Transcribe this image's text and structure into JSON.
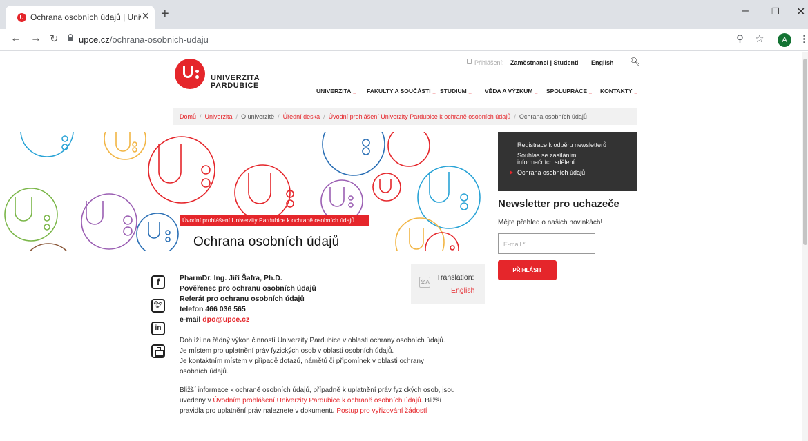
{
  "browser": {
    "tab_title": "Ochrana osobních údajů | Univerz",
    "url_domain": "upce.cz",
    "url_path": "/ochrana-osobnich-udaju",
    "profile_initial": "A"
  },
  "header": {
    "logo_line1": "UNIVERZITA",
    "logo_line2": "PARDUBICE",
    "login_label": "Přihlášení:",
    "login_links": "Zaměstnanci | Studenti",
    "lang": "English"
  },
  "nav": [
    "UNIVERZITA",
    "FAKULTY A SOUČÁSTI",
    "STUDIUM",
    "VĚDA A VÝZKUM",
    "SPOLUPRÁCE",
    "KONTAKTY"
  ],
  "breadcrumb": {
    "links": [
      "Domů",
      "Univerzita"
    ],
    "plain1": "O univerzitě",
    "links2": [
      "Úřední deska",
      "Úvodní prohlášení Univerzity Pardubice k ochraně osobních údajů"
    ],
    "current": "Ochrana osobních údajů"
  },
  "hero": {
    "label": "Úvodní prohlášení Univerzity Pardubice k ochraně osobních údajů",
    "title": "Ochrana osobních údajů"
  },
  "sidebar": {
    "items": [
      "Registrace k odběru newsletterů",
      "Souhlas se zasíláním",
      "informačních sdělení",
      "Ochrana osobních údajů"
    ],
    "newsletter_title": "Newsletter pro uchazeče",
    "newsletter_text": "Mějte přehled o našich novinkách!",
    "email_placeholder": "E-mail *",
    "submit": "PŘIHLÁSIT"
  },
  "contact": {
    "name": "PharmDr. Ing. Jiří Šafra, Ph.D.",
    "role1": "Pověřenec pro ochranu osobních údajů",
    "role2": "Referát pro ochranu osobních údajů",
    "phone": "telefon 466 036 565",
    "email_prefix": "e-mail ",
    "email": "dpo@upce.cz"
  },
  "translation": {
    "label": "Translation:",
    "link": "English"
  },
  "paragraphs": {
    "p1_lines": [
      "Dohlíží na řádný výkon činností Univerzity Pardubice v oblasti ochrany osobních údajů.",
      "Je místem pro uplatnění práv fyzických osob v oblasti osobních údajů.",
      "Je kontaktním místem v případě dotazů, námětů či připomínek v oblasti ochrany",
      "osobních údajů."
    ],
    "p2_line1": "Bližší informace k ochraně osobních údajů, případně k uplatnění práv fyzických osob, jsou",
    "p2_line2_pre": "uvedeny v ",
    "p2_line2_link": "Úvodním prohlášení Univerzity Pardubice k ochraně osobních údajů",
    "p2_line2_post": ". Bližší",
    "p2_line3_pre": "pravidla pro uplatnění práv naleznete v dokumentu ",
    "p2_line3_link": "Postup pro vyřizování žádostí"
  }
}
